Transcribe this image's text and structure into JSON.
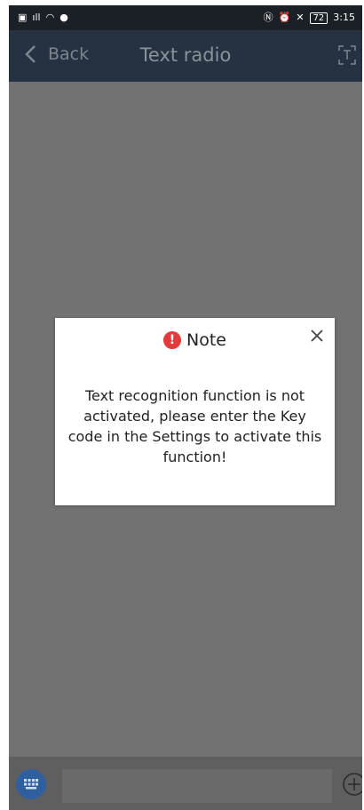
{
  "status_bar": {
    "left_icons": [
      "hd-icon",
      "4g-signal-icon",
      "wifi-icon",
      "app-notification-icon"
    ],
    "right_icons": [
      "nfc-icon",
      "alarm-icon",
      "mute-icon"
    ],
    "battery": "72",
    "time": "3:15"
  },
  "header": {
    "back_label": "Back",
    "title": "Text radio",
    "action_icon": "text-scan-icon"
  },
  "dialog": {
    "title": "Note",
    "message": "Text recognition function is not activated, please enter the Key code in the Settings to activate this function!",
    "icon": "warning-icon",
    "close_icon": "close-icon"
  },
  "bottom_bar": {
    "keyboard_icon": "keyboard-icon",
    "input_value": "",
    "add_icon": "plus-icon"
  },
  "colors": {
    "navbar": "#263241",
    "overlay": "#727272",
    "warning": "#e33b3b",
    "keyboard_button": "#2f5f9e"
  }
}
